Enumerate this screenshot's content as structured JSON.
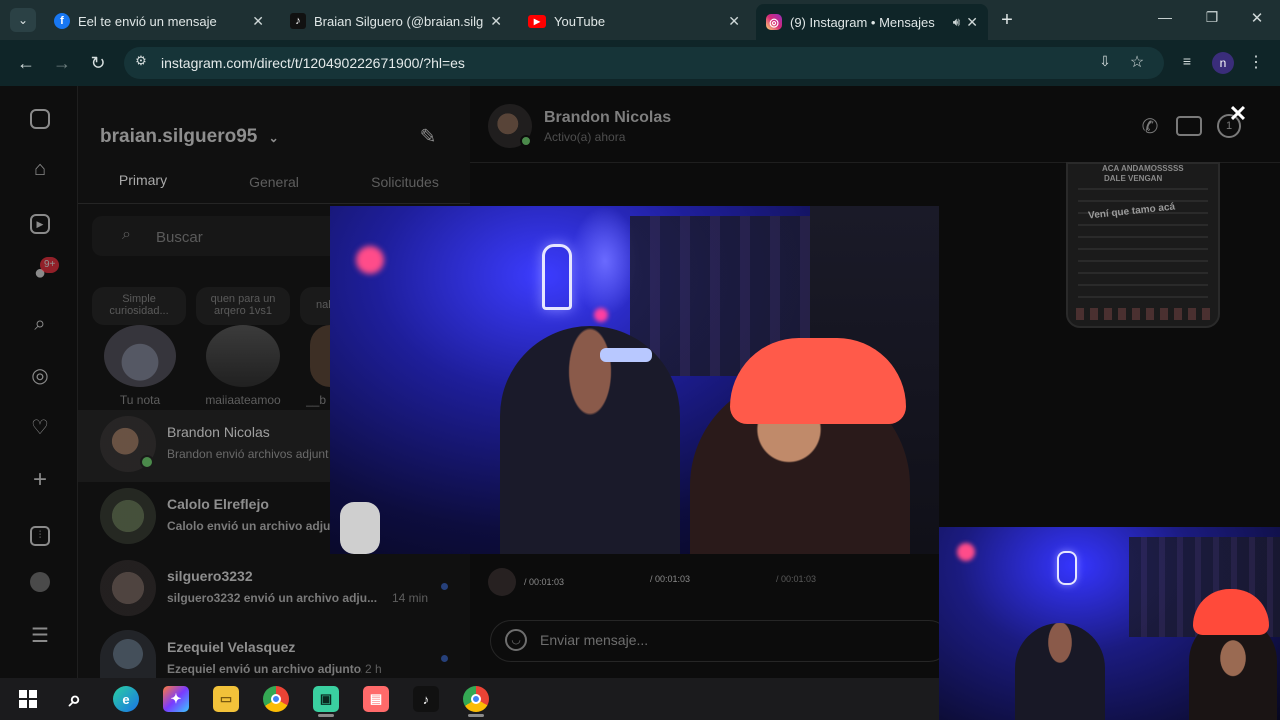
{
  "browser": {
    "tabs": [
      {
        "title": "Eel te envió un mensaje",
        "icon": "facebook-icon",
        "color": "#1877f2"
      },
      {
        "title": "Braian Silguero (@braian.silgue",
        "icon": "tiktok-icon",
        "color": "#111111"
      },
      {
        "title": "YouTube",
        "icon": "youtube-icon",
        "color": "#ff0000"
      },
      {
        "title": "(9) Instagram • Mensajes",
        "icon": "instagram-icon",
        "color": "#d6249f"
      }
    ],
    "url": "instagram.com/direct/t/120490222671900/?hl=es",
    "profile_initial": "n"
  },
  "sidebar": {
    "notification_badge": "9+"
  },
  "inbox": {
    "username": "braian.silguero95",
    "tabs": [
      "Primary",
      "General",
      "Solicitudes"
    ],
    "search_placeholder": "Buscar",
    "notes": [
      {
        "bubble": "Simple curiosidad...",
        "label": "Tu nota"
      },
      {
        "bubble": "quen para un arqero 1vs1",
        "label": "maiiaateamoo"
      },
      {
        "bubble": "nal",
        "label": "__b"
      }
    ],
    "threads": [
      {
        "name": "Brandon Nicolas",
        "preview": "Brandon envió archivos adjunt",
        "time": ""
      },
      {
        "name": "Calolo Elreflejo",
        "preview": "Calolo envió un archivo adjun",
        "time": ""
      },
      {
        "name": "silguero3232",
        "preview": "silguero3232 envió un archivo adju...",
        "time": "14 min"
      },
      {
        "name": "Ezequiel Velasquez",
        "preview": "Ezequiel envió un archivo adjunto.",
        "time": "2 h"
      }
    ]
  },
  "chat": {
    "contact_name": "Brandon Nicolas",
    "status": "Activo(a) ahora",
    "info_badge": "1",
    "message_placeholder": "Enviar mensaje...",
    "media_times": [
      "/ 00:01:03",
      "/ 00:01:03",
      "/ 00:01:03"
    ],
    "screenshot_texts": [
      "ACA ANDAMOSSSSS",
      "DALE VENGAN",
      "Vení que tamo acá"
    ]
  },
  "colors": {
    "accent": "#0095f6",
    "badge": "#ff3040",
    "neon": "#3b3bff",
    "cap": "#ff5a4a"
  }
}
